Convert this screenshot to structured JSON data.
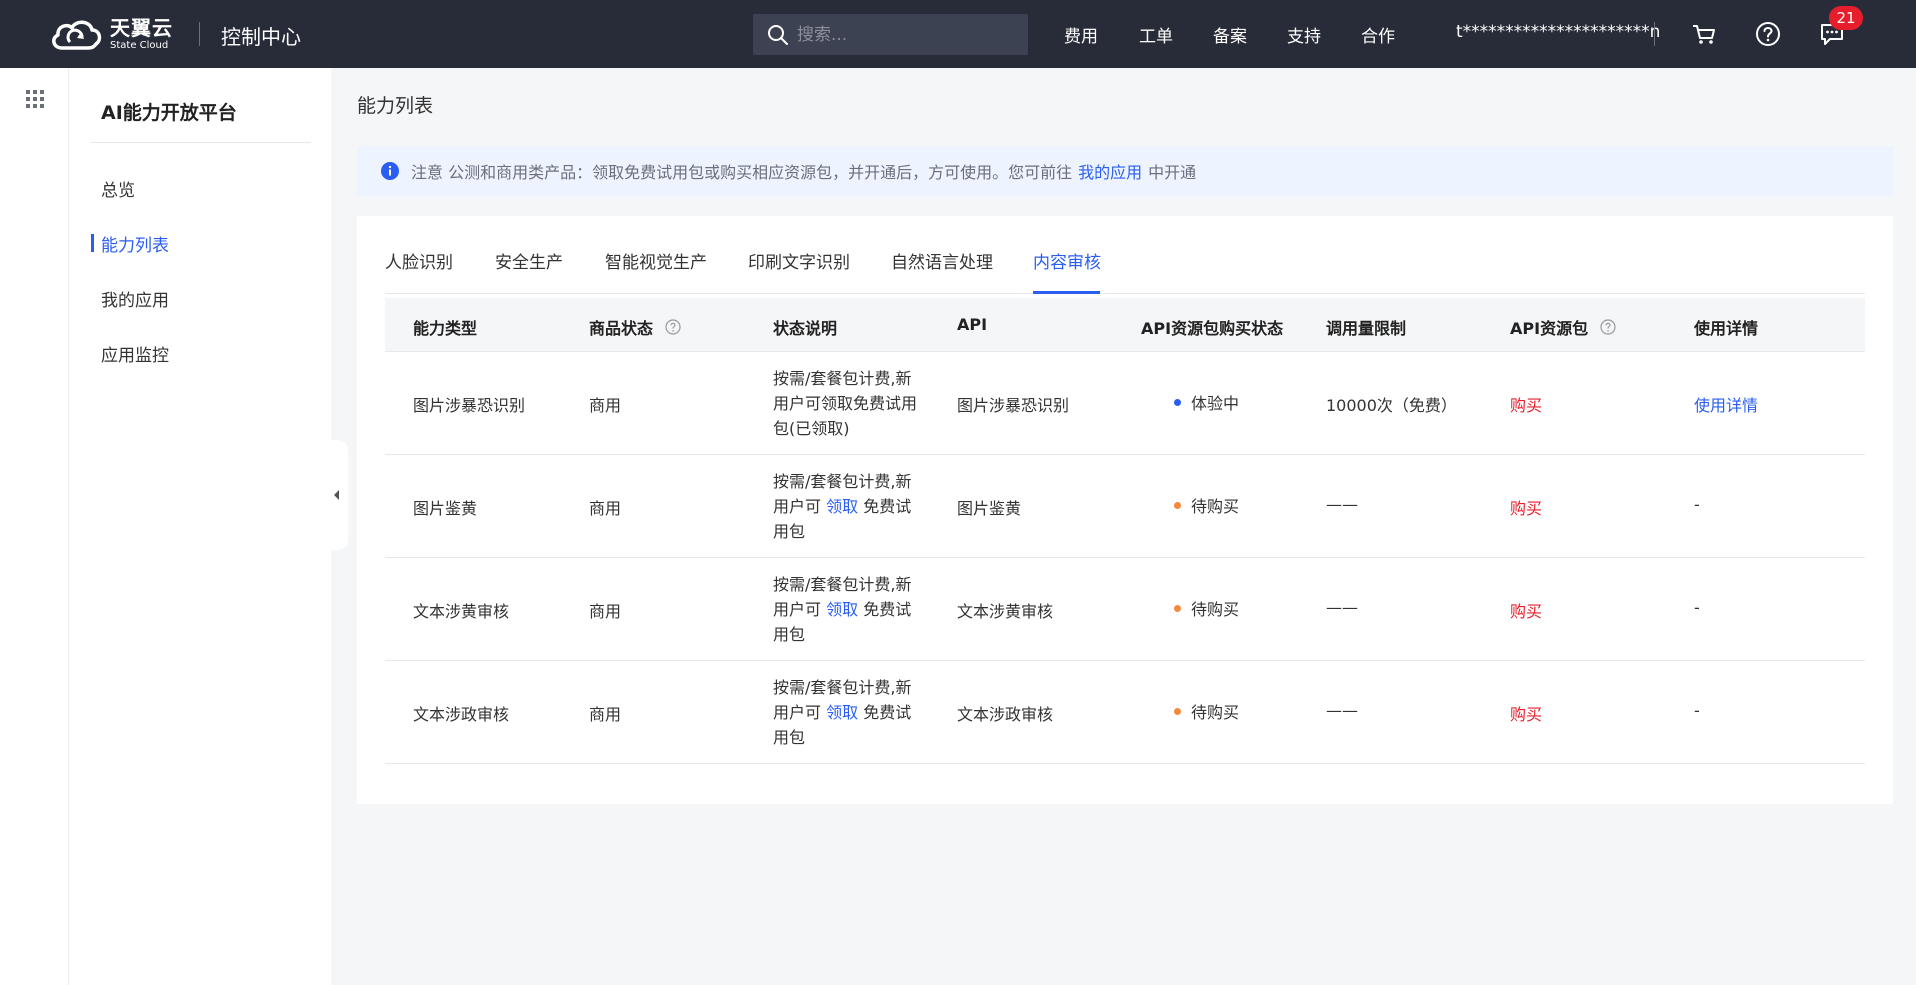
{
  "header": {
    "logo_cn": "天翼云",
    "logo_en": "State Cloud",
    "console_title": "控制中心",
    "search_placeholder": "搜索...",
    "nav": [
      "费用",
      "工单",
      "备案",
      "支持",
      "合作"
    ],
    "user": "t**********************n",
    "icons": [
      "cart-icon",
      "help-icon",
      "message-icon"
    ],
    "badge_count": "21"
  },
  "sidebar": {
    "title": "AI能力开放平台",
    "items": [
      {
        "label": "总览",
        "active": false
      },
      {
        "label": "能力列表",
        "active": true
      },
      {
        "label": "我的应用",
        "active": false
      },
      {
        "label": "应用监控",
        "active": false
      }
    ]
  },
  "main": {
    "page_title": "能力列表",
    "notice": {
      "prefix": "注意 公测和商用类产品：领取免费试用包或购买相应资源包，并开通后，方可使用。您可前往",
      "link": "我的应用",
      "suffix": "中开通"
    },
    "tabs": [
      {
        "label": "人脸识别",
        "active": false
      },
      {
        "label": "安全生产",
        "active": false
      },
      {
        "label": "智能视觉生产",
        "active": false
      },
      {
        "label": "印刷文字识别",
        "active": false
      },
      {
        "label": "自然语言处理",
        "active": false
      },
      {
        "label": "内容审核",
        "active": true
      }
    ],
    "table": {
      "columns": [
        "能力类型",
        "商品状态",
        "状态说明",
        "API",
        "API资源包购买状态",
        "调用量限制",
        "API资源包",
        "使用详情"
      ],
      "rows": [
        {
          "type": "图片涉暴恐识别",
          "status": "商用",
          "desc_pre": "按需/套餐包计费,新用户可领取免费试用包(已领取)",
          "desc_link": "",
          "desc_post": "",
          "api": "图片涉暴恐识别",
          "purchase_status": "体验中",
          "dot_color": "#2a5ef2",
          "limit": "10000次（免费）",
          "package": "购买",
          "detail": "使用详情"
        },
        {
          "type": "图片鉴黄",
          "status": "商用",
          "desc_pre": "按需/套餐包计费,新用户可",
          "desc_link": "领取",
          "desc_post": "免费试用包",
          "api": "图片鉴黄",
          "purchase_status": "待购买",
          "dot_color": "#f5883a",
          "limit": "——",
          "package": "购买",
          "detail": "-"
        },
        {
          "type": "文本涉黄审核",
          "status": "商用",
          "desc_pre": "按需/套餐包计费,新用户可",
          "desc_link": "领取",
          "desc_post": "免费试用包",
          "api": "文本涉黄审核",
          "purchase_status": "待购买",
          "dot_color": "#f5883a",
          "limit": "——",
          "package": "购买",
          "detail": "-"
        },
        {
          "type": "文本涉政审核",
          "status": "商用",
          "desc_pre": "按需/套餐包计费,新用户可",
          "desc_link": "领取",
          "desc_post": "免费试用包",
          "api": "文本涉政审核",
          "purchase_status": "待购买",
          "dot_color": "#f5883a",
          "limit": "——",
          "package": "购买",
          "detail": "-"
        }
      ]
    }
  },
  "colors": {
    "header_bg": "#282c38",
    "accent": "#2a5ef2",
    "buy": "#e61e2b",
    "notice_bg": "#eef4ff"
  }
}
